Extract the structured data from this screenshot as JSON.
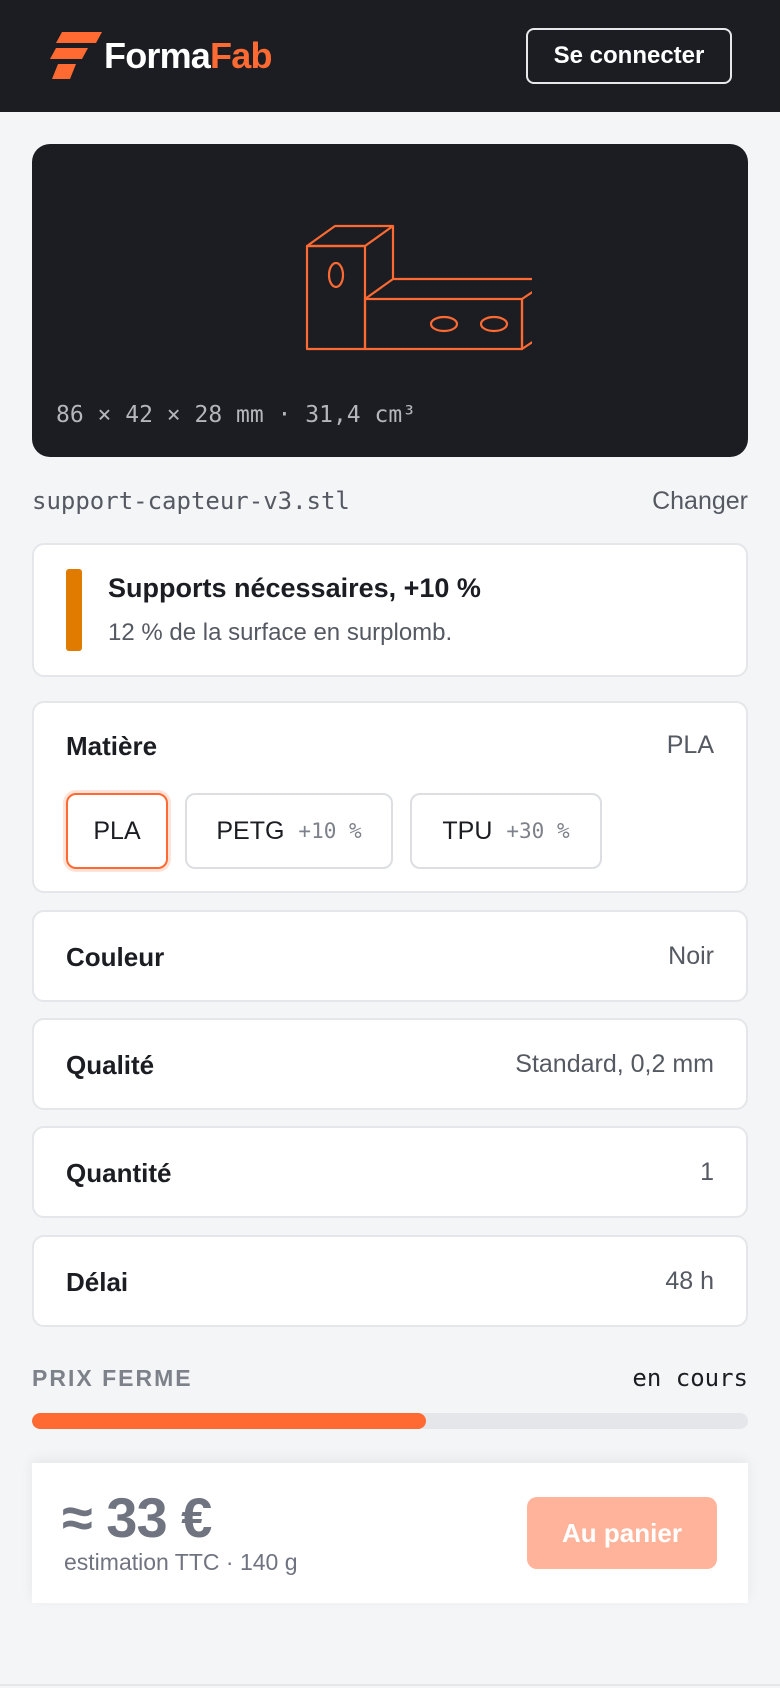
{
  "header": {
    "logo_part1": "Forma",
    "logo_part2": "Fab",
    "login_label": "Se connecter"
  },
  "preview": {
    "dimensions": "86 × 42 × 28 mm · 31,4 cm³",
    "icon": "bracket-model-icon"
  },
  "file": {
    "name": "support-capteur-v3.stl",
    "change_label": "Changer"
  },
  "warning": {
    "title": "Supports nécessaires, +10 %",
    "detail": "12 % de la surface en surplomb.",
    "color": "#e07b00"
  },
  "options": {
    "matiere": {
      "label": "Matière",
      "value": "PLA",
      "choices": [
        {
          "label": "PLA",
          "extra": ""
        },
        {
          "label": "PETG",
          "extra": "+10 %"
        },
        {
          "label": "TPU",
          "extra": "+30 %"
        }
      ]
    },
    "couleur": {
      "label": "Couleur",
      "value": "Noir"
    },
    "qualite": {
      "label": "Qualité",
      "value": "Standard, 0,2 mm"
    },
    "quantite": {
      "label": "Quantité",
      "value": "1"
    },
    "delai": {
      "label": "Délai",
      "value": "48 h"
    }
  },
  "pricing": {
    "label": "PRIX FERME",
    "status": "en cours",
    "progress": 0.55,
    "price": "≈ 33 €",
    "price_sub": "estimation TTC · 140 g",
    "cart_label": "Au panier"
  },
  "colors": {
    "accent": "#ff6a33",
    "dark": "#1b1d22",
    "warning": "#e07b00"
  }
}
